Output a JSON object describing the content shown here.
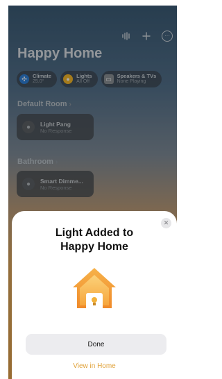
{
  "header": {
    "icons": [
      "waveform-icon",
      "plus-icon",
      "more-icon"
    ],
    "title": "Happy Home"
  },
  "chips": [
    {
      "title": "Climate",
      "subtitle": "25.0°",
      "icon": "fan-icon",
      "color": "#2f7fd6"
    },
    {
      "title": "Lights",
      "subtitle": "All Off",
      "icon": "bulb-icon",
      "color": "#f2b52a"
    },
    {
      "title": "Speakers & TVs",
      "subtitle": "None Playing",
      "icon": "tv-icon",
      "color": "#8a8f94"
    }
  ],
  "rooms": [
    {
      "name": "Default Room",
      "accessory": {
        "name": "Light Pang",
        "status": "No Response"
      }
    },
    {
      "name": "Bathroom",
      "accessory": {
        "name": "Smart Dimme...",
        "status": "No Response"
      }
    }
  ],
  "sheet": {
    "title_line1": "Light Added to",
    "title_line2": "Happy Home",
    "done_label": "Done",
    "view_label": "View in Home"
  },
  "colors": {
    "accent": "#e0a23a",
    "house": "#f2a13a"
  }
}
